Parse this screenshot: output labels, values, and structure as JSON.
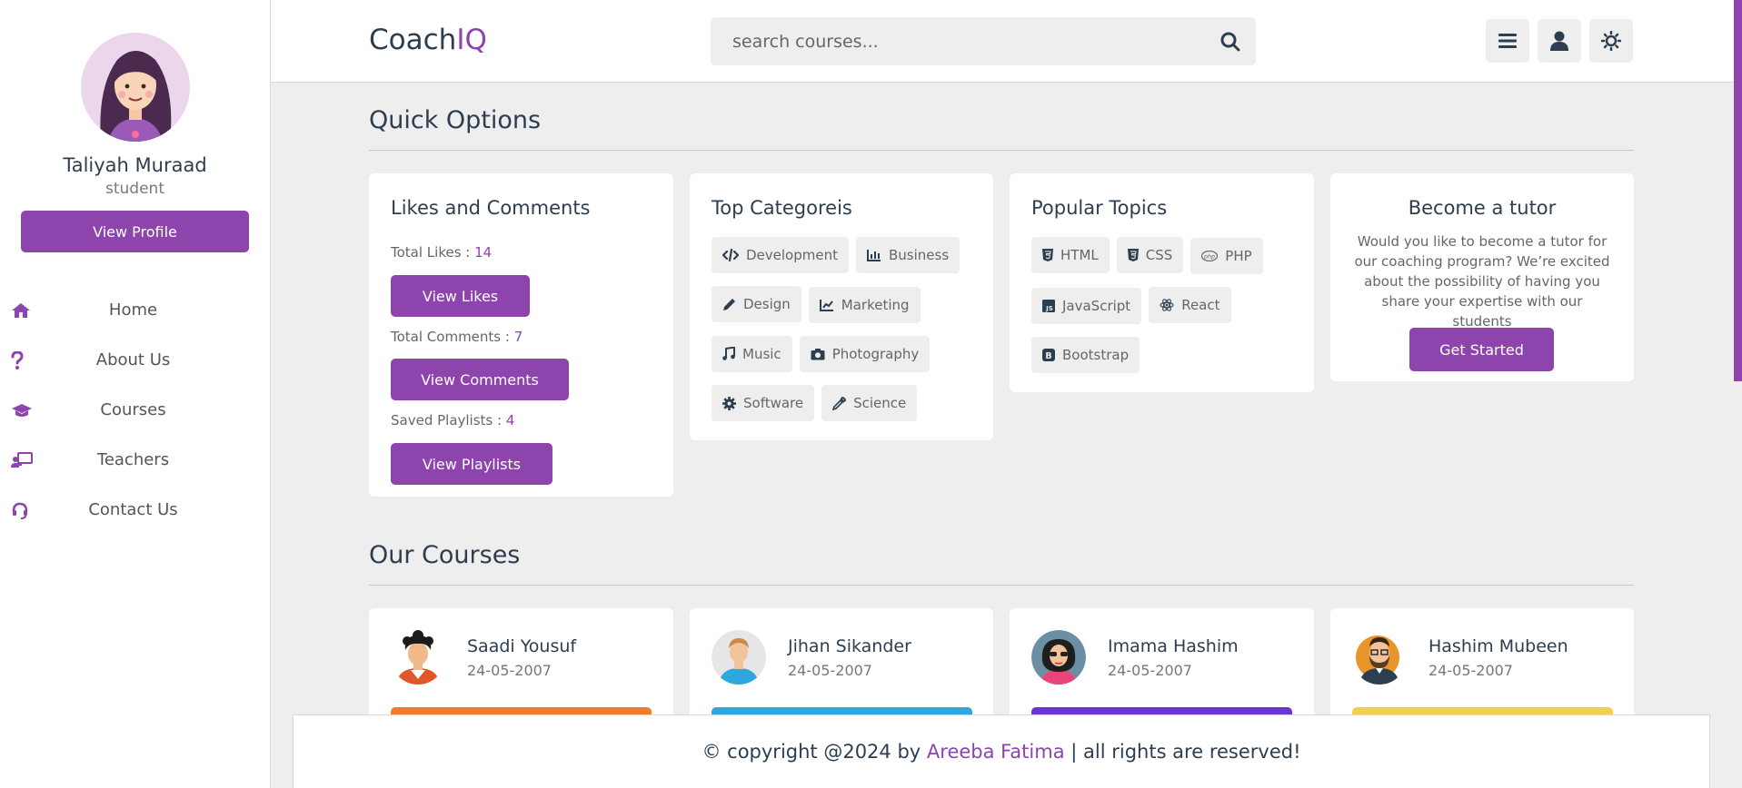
{
  "sidebar": {
    "profile": {
      "name": "Taliyah Muraad",
      "role": "student",
      "button_label": "View Profile"
    },
    "nav": [
      {
        "label": "Home",
        "icon": "home-icon"
      },
      {
        "label": "About Us",
        "icon": "question-icon"
      },
      {
        "label": "Courses",
        "icon": "graduation-cap-icon"
      },
      {
        "label": "Teachers",
        "icon": "chalkboard-teacher-icon"
      },
      {
        "label": "Contact Us",
        "icon": "headset-icon"
      }
    ]
  },
  "header": {
    "logo_main": "Coach",
    "logo_accent": "IQ",
    "search_placeholder": "search courses...",
    "buttons": [
      "menu-icon",
      "user-icon",
      "theme-toggle-icon"
    ]
  },
  "quick_options": {
    "title": "Quick Options",
    "likes_card": {
      "title": "Likes and Comments",
      "likes_label": "Total Likes : ",
      "likes_value": "14",
      "likes_button": "View Likes",
      "comments_label": "Total Comments : ",
      "comments_value": "7",
      "comments_button": "View Comments",
      "playlists_label": "Saved Playlists : ",
      "playlists_value": "4",
      "playlists_button": "View Playlists"
    },
    "categories_card": {
      "title": "Top Categoreis",
      "tags": [
        "Development",
        "Business",
        "Design",
        "Marketing",
        "Music",
        "Photography",
        "Software",
        "Science"
      ]
    },
    "topics_card": {
      "title": "Popular Topics",
      "tags": [
        "HTML",
        "CSS",
        "PHP",
        "JavaScript",
        "React",
        "Bootstrap"
      ]
    },
    "tutor_card": {
      "title": "Become a tutor",
      "text": "Would you like to become a tutor for our coaching program? We’re excited about the possibility of having you share your expertise with our students",
      "button": "Get Started"
    }
  },
  "courses": {
    "title": "Our Courses",
    "items": [
      {
        "name": "Saadi Yousuf",
        "date": "24-05-2007",
        "thumb_color": "#f07b2a"
      },
      {
        "name": "Jihan Sikander",
        "date": "24-05-2007",
        "thumb_color": "#2ea8dc"
      },
      {
        "name": "Imama Hashim",
        "date": "24-05-2007",
        "thumb_color": "#6a35d8"
      },
      {
        "name": "Hashim Mubeen",
        "date": "24-05-2007",
        "thumb_color": "#f2d04e"
      }
    ]
  },
  "footer": {
    "prefix": "© copyright @2024 by ",
    "author": "Areeba Fatima",
    "suffix": " | all rights are reserved!"
  },
  "colors": {
    "accent": "#8e44ad",
    "background": "#eeeeee",
    "text": "#2c3e50"
  }
}
